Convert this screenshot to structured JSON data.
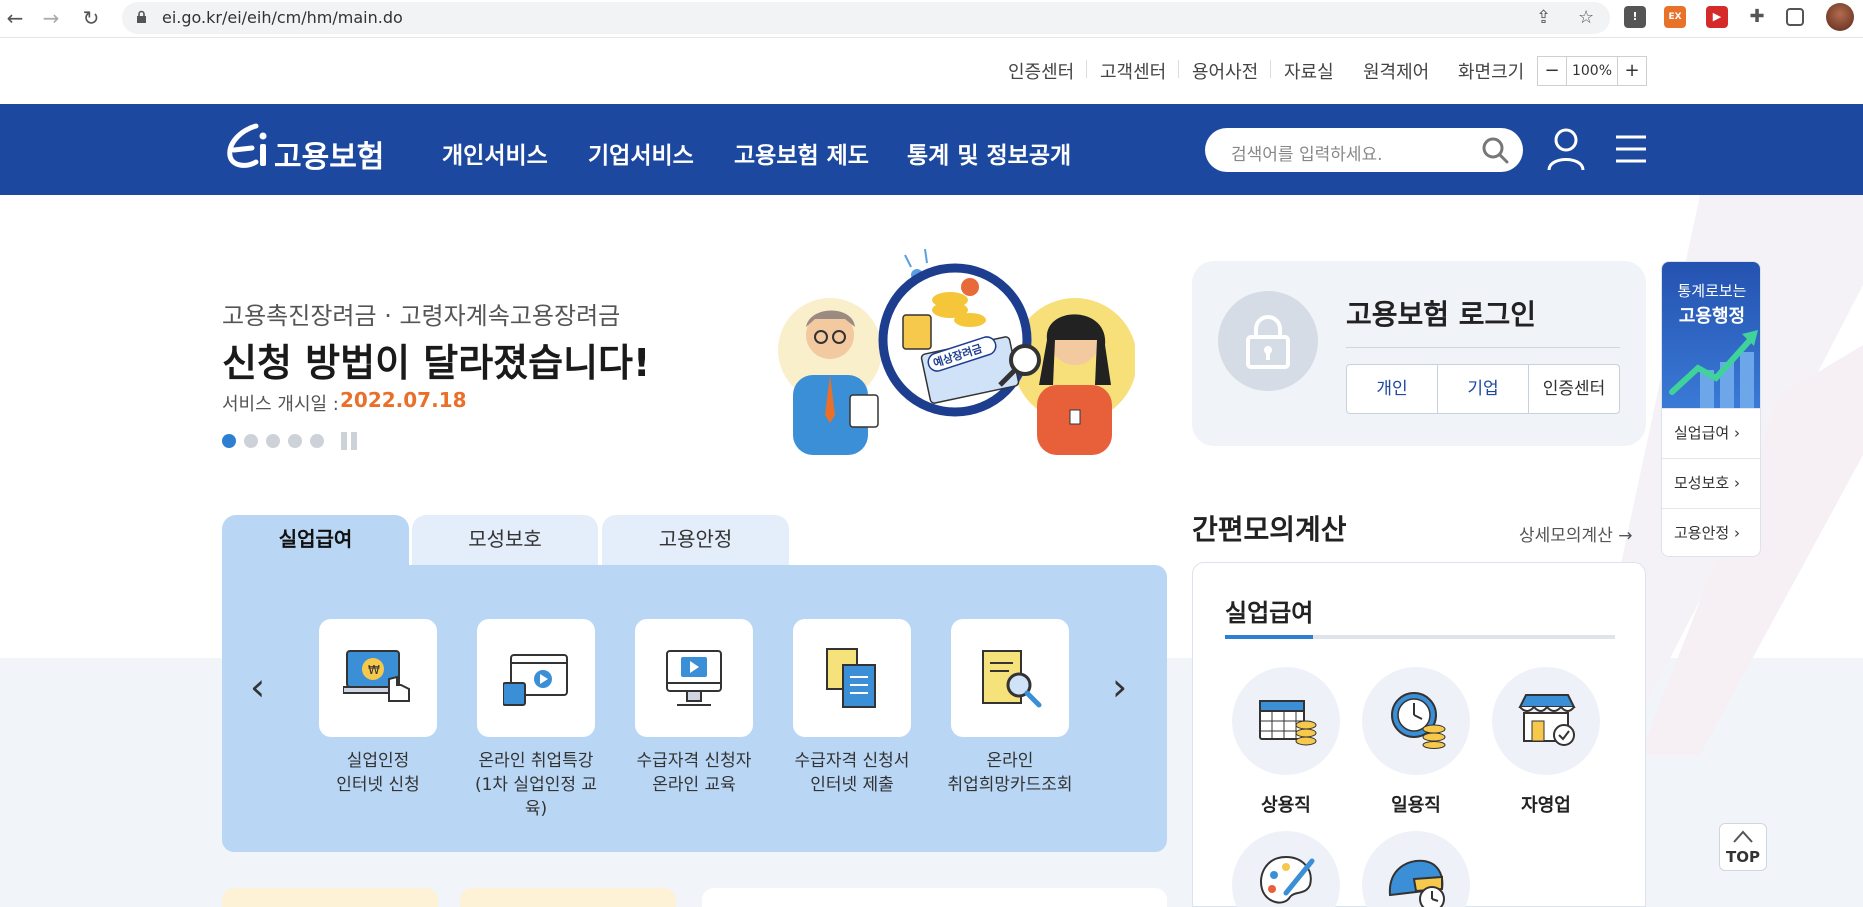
{
  "browser": {
    "url": "ei.go.kr/ei/eih/cm/hm/main.do"
  },
  "utility": {
    "links": [
      "인증센터",
      "고객센터",
      "용어사전",
      "자료실",
      "원격제어"
    ],
    "screen_size_label": "화면크기",
    "zoom_minus": "−",
    "zoom_value": "100%",
    "zoom_plus": "+"
  },
  "header": {
    "logo_text": "고용보험",
    "nav": [
      "개인서비스",
      "기업서비스",
      "고용보험 제도",
      "통계 및 정보공개"
    ],
    "search_placeholder": "검색어를 입력하세요."
  },
  "banner": {
    "subtitle": "고용촉진장려금 · 고령자계속고용장려금",
    "title": "신청 방법이 달라졌습니다!",
    "date_label": "서비스 개시일 :",
    "date": "2022.07.18",
    "illustration_sign": "예상장려금",
    "slide_count": 5,
    "active_slide": 1
  },
  "login": {
    "title": "고용보험 로그인",
    "buttons": [
      "개인",
      "기업",
      "인증센터"
    ]
  },
  "quick": {
    "title_small": "통계로보는",
    "title_big": "고용행정",
    "items": [
      "실업급여",
      "모성보호",
      "고용안정"
    ],
    "top_label": "TOP"
  },
  "tabs": {
    "items": [
      "실업급여",
      "모성보호",
      "고용안정"
    ],
    "active": 0,
    "services": [
      {
        "line1": "실업인정",
        "line2": "인터넷 신청"
      },
      {
        "line1": "온라인 취업특강",
        "line2": "(1차 실업인정 교육)"
      },
      {
        "line1": "수급자격 신청자",
        "line2": "온라인 교육"
      },
      {
        "line1": "수급자격 신청서",
        "line2": "인터넷 제출"
      },
      {
        "line1": "온라인",
        "line2": "취업희망카드조회"
      }
    ]
  },
  "calc": {
    "title": "간편모의계산",
    "more": "상세모의계산",
    "card_title": "실업급여",
    "items": [
      "상용직",
      "일용직",
      "자영업"
    ]
  }
}
